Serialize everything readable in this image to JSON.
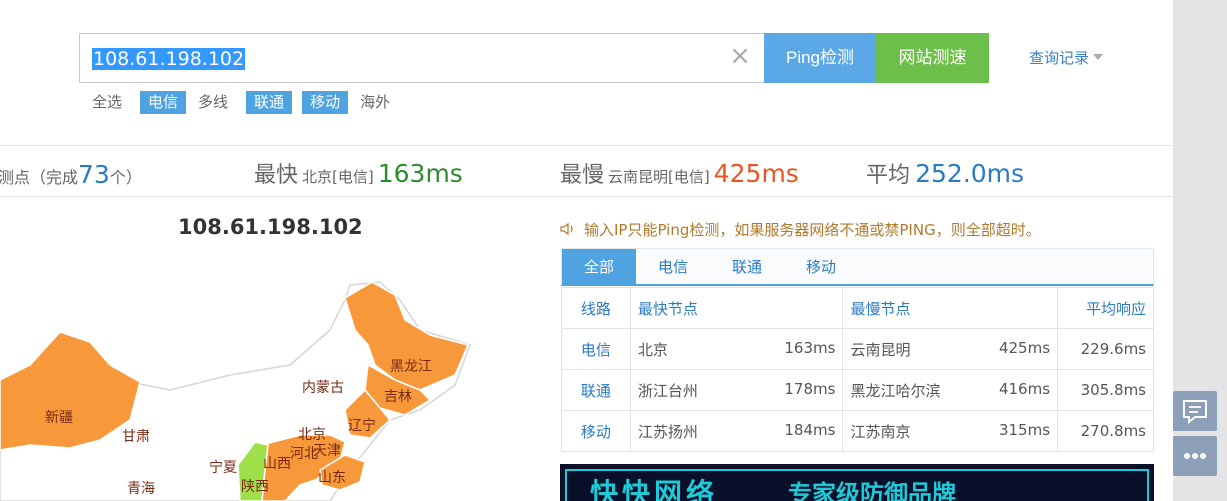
{
  "search": {
    "value": "108.61.198.102",
    "clear_icon": "close-icon"
  },
  "buttons": {
    "ping": "Ping检测",
    "speed": "网站测速",
    "history": "查询记录"
  },
  "filters": [
    {
      "label": "全选",
      "active": false
    },
    {
      "label": "电信",
      "active": true
    },
    {
      "label": "多线",
      "active": false
    },
    {
      "label": "联通",
      "active": true
    },
    {
      "label": "移动",
      "active": true
    },
    {
      "label": "海外",
      "active": false
    }
  ],
  "summary": {
    "done_prefix": "测点（完成",
    "done_count": "73",
    "done_suffix": "个）",
    "fastest_label": "最快",
    "fastest_node": "北京[电信]",
    "fastest_value": "163ms",
    "slowest_label": "最慢",
    "slowest_node": "云南昆明[电信]",
    "slowest_value": "425ms",
    "avg_label": "平均",
    "avg_value": "252.0ms"
  },
  "map": {
    "title": "108.61.198.102",
    "provinces": [
      "黑龙江",
      "内蒙古",
      "吉林",
      "新疆",
      "辽宁",
      "甘肃",
      "北京",
      "天津",
      "河北",
      "宁夏",
      "山西",
      "青海",
      "陕西",
      "山东"
    ]
  },
  "notice": "输入IP只能Ping检测，如果服务器网络不通或禁PING，则全部超时。",
  "tabs": [
    "全部",
    "电信",
    "联通",
    "移动"
  ],
  "table": {
    "headers": {
      "line": "线路",
      "fastest": "最快节点",
      "slowest": "最慢节点",
      "avg": "平均响应"
    },
    "rows": [
      {
        "line": "电信",
        "fast_node": "北京",
        "fast_ms": "163ms",
        "slow_node": "云南昆明",
        "slow_ms": "425ms",
        "avg": "229.6ms"
      },
      {
        "line": "联通",
        "fast_node": "浙江台州",
        "fast_ms": "178ms",
        "slow_node": "黑龙江哈尔滨",
        "slow_ms": "416ms",
        "avg": "305.8ms"
      },
      {
        "line": "移动",
        "fast_node": "江苏扬州",
        "fast_ms": "184ms",
        "slow_node": "江苏南京",
        "slow_ms": "315ms",
        "avg": "270.8ms"
      }
    ]
  },
  "ad": {
    "logo": "快快网络",
    "slogan": "专家级防御品牌"
  },
  "side": {
    "feedback_icon": "chat-icon",
    "more_icon": "more-icon"
  },
  "colors": {
    "fast": "#2e8b2e",
    "slow": "#e8551f",
    "avg": "#2a7bc4",
    "province_orange": "#f7983a",
    "province_green": "#9fe04a"
  }
}
